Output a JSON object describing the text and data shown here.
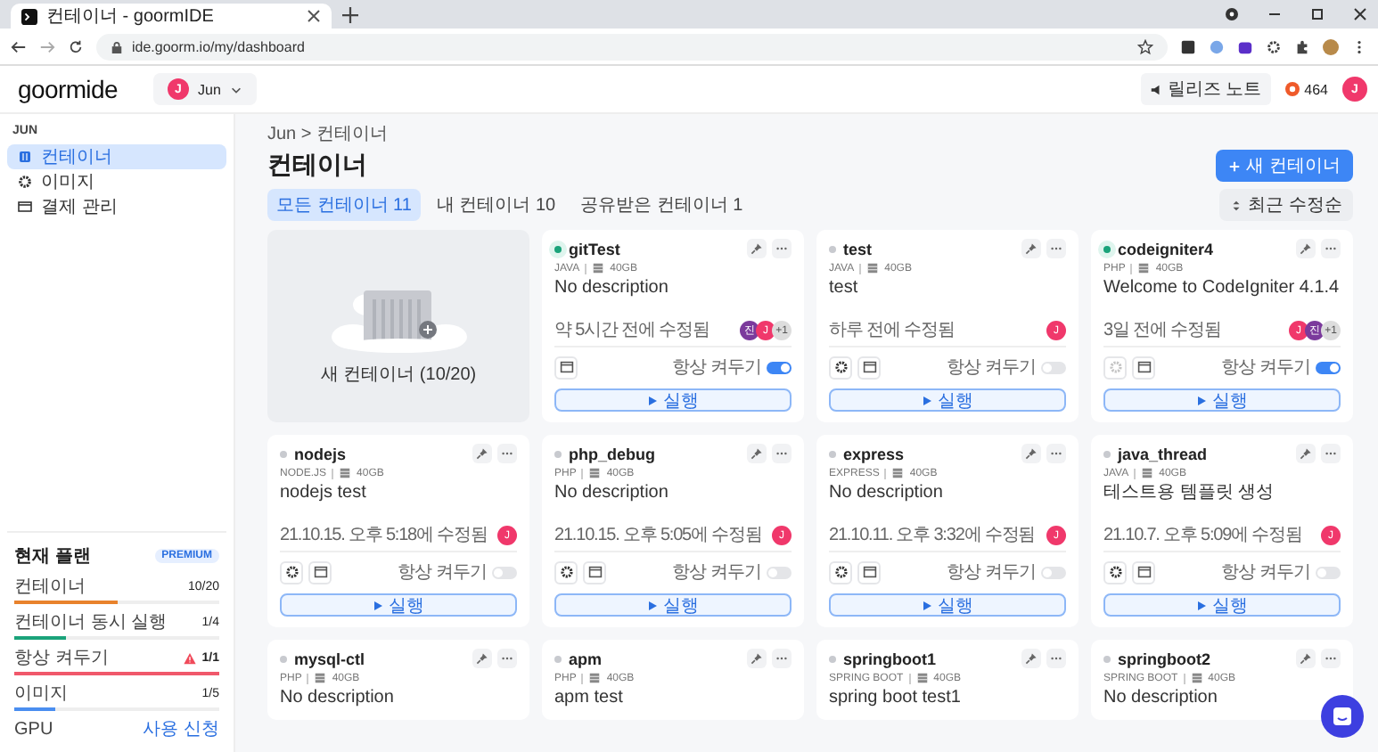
{
  "browser": {
    "tab_title": "컨테이너 - goormIDE",
    "url": "ide.goorm.io/my/dashboard"
  },
  "header": {
    "logo": "goormide",
    "workspace": {
      "initial": "J",
      "name": "Jun"
    },
    "release_notes": "릴리즈 노트",
    "points": "464",
    "user_initial": "J"
  },
  "sidebar": {
    "section": "JUN",
    "items": [
      {
        "label": "컨테이너",
        "selected": true
      },
      {
        "label": "이미지",
        "selected": false
      },
      {
        "label": "결제 관리",
        "selected": false
      }
    ],
    "plan": {
      "title": "현재 플랜",
      "badge": "PREMIUM",
      "usages": [
        {
          "label": "컨테이너",
          "value": "10/20",
          "level": 0.5,
          "color": "#e8822c",
          "warning": false
        },
        {
          "label": "컨테이너 동시 실행",
          "value": "1/4",
          "level": 0.25,
          "color": "#1aa37a",
          "warning": false
        },
        {
          "label": "항상 켜두기",
          "value": "1/1",
          "level": 1,
          "color": "#f0586b",
          "warning": true
        },
        {
          "label": "이미지",
          "value": "1/5",
          "level": 0.2,
          "color": "#4a8ef0",
          "warning": false
        }
      ],
      "gpu": {
        "label": "GPU",
        "link": "사용 신청"
      }
    }
  },
  "main": {
    "breadcrumb": "Jun > 컨테이너",
    "title": "컨테이너",
    "new_button": "새 컨테이너",
    "tabs": [
      {
        "label": "모든 컨테이너",
        "count": "11",
        "selected": true
      },
      {
        "label": "내 컨테이너",
        "count": "10",
        "selected": false
      },
      {
        "label": "공유받은 컨테이너",
        "count": "1",
        "selected": false
      }
    ],
    "sort": "최근 수정순",
    "new_card": "새 컨테이너 (10/20)",
    "containers": [
      {
        "name": "gitTest",
        "running": true,
        "stack": "JAVA",
        "disk": "40GB",
        "description": "No description",
        "modified": "약 5시간 전에 수정됨",
        "members": [
          {
            "initial": "진",
            "color": "#7b3a9c"
          },
          {
            "initial": "J",
            "color": "#f0386b"
          }
        ],
        "more": "+1",
        "has_settings": false,
        "always_on_label": "항상 켜두기",
        "always_on": true,
        "run": "실행"
      },
      {
        "name": "test",
        "running": false,
        "stack": "JAVA",
        "disk": "40GB",
        "description": "test",
        "modified": "하루 전에 수정됨",
        "members": [
          {
            "initial": "J",
            "color": "#f0386b"
          }
        ],
        "has_settings": true,
        "settings_disabled": false,
        "always_on_label": "항상 켜두기",
        "always_on": false,
        "run": "실행"
      },
      {
        "name": "codeigniter4",
        "running": true,
        "stack": "PHP",
        "disk": "40GB",
        "description": "Welcome to CodeIgniter 4.1.4",
        "modified": "3일 전에 수정됨",
        "members": [
          {
            "initial": "J",
            "color": "#f0386b"
          },
          {
            "initial": "진",
            "color": "#7b3a9c"
          }
        ],
        "more": "+1",
        "has_settings": true,
        "settings_disabled": true,
        "always_on_label": "항상 켜두기",
        "always_on": true,
        "run": "실행"
      },
      {
        "name": "nodejs",
        "running": false,
        "stack": "NODE.JS",
        "disk": "40GB",
        "description": "nodejs test",
        "modified": "21.10.15. 오후 5:18에 수정됨",
        "members": [
          {
            "initial": "J",
            "color": "#f0386b"
          }
        ],
        "has_settings": true,
        "settings_disabled": false,
        "always_on_label": "항상 켜두기",
        "always_on": false,
        "run": "실행"
      },
      {
        "name": "php_debug",
        "running": false,
        "stack": "PHP",
        "disk": "40GB",
        "description": "No description",
        "modified": "21.10.15. 오후 5:05에 수정됨",
        "members": [
          {
            "initial": "J",
            "color": "#f0386b"
          }
        ],
        "has_settings": true,
        "settings_disabled": false,
        "always_on_label": "항상 켜두기",
        "always_on": false,
        "run": "실행"
      },
      {
        "name": "express",
        "running": false,
        "stack": "EXPRESS",
        "disk": "40GB",
        "description": "No description",
        "modified": "21.10.11. 오후 3:32에 수정됨",
        "members": [
          {
            "initial": "J",
            "color": "#f0386b"
          }
        ],
        "has_settings": true,
        "settings_disabled": false,
        "always_on_label": "항상 켜두기",
        "always_on": false,
        "run": "실행"
      },
      {
        "name": "java_thread",
        "running": false,
        "stack": "JAVA",
        "disk": "40GB",
        "description": "테스트용 템플릿 생성",
        "modified": "21.10.7. 오후 5:09에 수정됨",
        "members": [
          {
            "initial": "J",
            "color": "#f0386b"
          }
        ],
        "has_settings": true,
        "settings_disabled": false,
        "always_on_label": "항상 켜두기",
        "always_on": false,
        "run": "실행"
      },
      {
        "name": "mysql-ctl",
        "running": false,
        "stack": "PHP",
        "disk": "40GB",
        "description": "No description"
      },
      {
        "name": "apm",
        "running": false,
        "stack": "PHP",
        "disk": "40GB",
        "description": "apm test"
      },
      {
        "name": "springboot1",
        "running": false,
        "stack": "SPRING BOOT",
        "disk": "40GB",
        "description": "spring boot test1"
      },
      {
        "name": "springboot2",
        "running": false,
        "stack": "SPRING BOOT",
        "disk": "40GB",
        "description": "No description"
      }
    ]
  }
}
